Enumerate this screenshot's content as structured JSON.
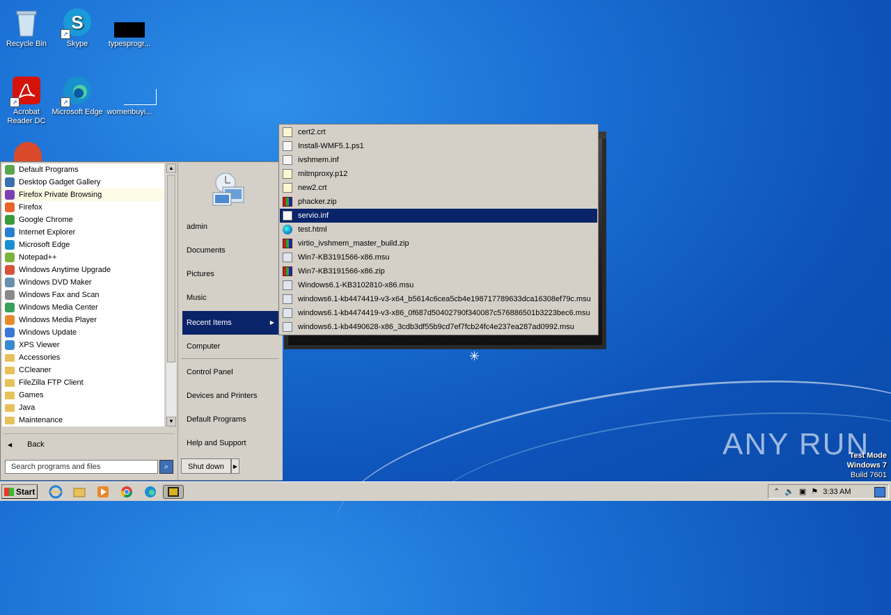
{
  "desktop": {
    "icons": [
      {
        "label": "Recycle Bin"
      },
      {
        "label": "Skype"
      },
      {
        "label": "typesprogr..."
      },
      {
        "label": "Acrobat Reader DC"
      },
      {
        "label": "Microsoft Edge"
      },
      {
        "label": "womenbuyi..."
      }
    ]
  },
  "start_menu": {
    "programs": [
      {
        "label": "Default Programs",
        "icon": "default-programs-icon",
        "color": "#5aa64a"
      },
      {
        "label": "Desktop Gadget Gallery",
        "icon": "gadget-icon",
        "color": "#3a6fb0"
      },
      {
        "label": "Firefox Private Browsing",
        "icon": "firefox-private-icon",
        "color": "#7b3fb5"
      },
      {
        "label": "Firefox",
        "icon": "firefox-icon",
        "color": "#e8632b"
      },
      {
        "label": "Google Chrome",
        "icon": "chrome-icon",
        "color": "#3a9a3a"
      },
      {
        "label": "Internet Explorer",
        "icon": "ie-icon",
        "color": "#2a7fd4"
      },
      {
        "label": "Microsoft Edge",
        "icon": "edge-icon",
        "color": "#1a8fd0"
      },
      {
        "label": "Notepad++",
        "icon": "notepadpp-icon",
        "color": "#7ab342"
      },
      {
        "label": "Windows Anytime Upgrade",
        "icon": "windows-flag-icon",
        "color": "#d9533a"
      },
      {
        "label": "Windows DVD Maker",
        "icon": "dvd-maker-icon",
        "color": "#6a8fb0"
      },
      {
        "label": "Windows Fax and Scan",
        "icon": "fax-icon",
        "color": "#8a8a8a"
      },
      {
        "label": "Windows Media Center",
        "icon": "media-center-icon",
        "color": "#3aa05a"
      },
      {
        "label": "Windows Media Player",
        "icon": "media-player-icon",
        "color": "#e8882b"
      },
      {
        "label": "Windows Update",
        "icon": "windows-update-icon",
        "color": "#3a7ad4"
      },
      {
        "label": "XPS Viewer",
        "icon": "xps-viewer-icon",
        "color": "#3a8ad0"
      },
      {
        "label": "Accessories",
        "icon": "folder-icon"
      },
      {
        "label": "CCleaner",
        "icon": "folder-icon"
      },
      {
        "label": "FileZilla FTP Client",
        "icon": "folder-icon"
      },
      {
        "label": "Games",
        "icon": "folder-icon"
      },
      {
        "label": "Java",
        "icon": "folder-icon"
      },
      {
        "label": "Maintenance",
        "icon": "folder-icon"
      }
    ],
    "back_label": "Back",
    "search_placeholder": "Search programs and files",
    "right": {
      "user": "admin",
      "documents": "Documents",
      "pictures": "Pictures",
      "music": "Music",
      "recent_items": "Recent Items",
      "computer": "Computer",
      "control_panel": "Control Panel",
      "devices_printers": "Devices and Printers",
      "default_programs": "Default Programs",
      "help_support": "Help and Support"
    },
    "shutdown_label": "Shut down"
  },
  "recent_items": [
    {
      "label": "cert2.crt",
      "type": "cert"
    },
    {
      "label": "Install-WMF5.1.ps1",
      "type": "script"
    },
    {
      "label": "ivshmem.inf",
      "type": "inf"
    },
    {
      "label": "mitmproxy.p12",
      "type": "cert"
    },
    {
      "label": "new2.crt",
      "type": "cert"
    },
    {
      "label": "phacker.zip",
      "type": "zip"
    },
    {
      "label": "servio.inf",
      "type": "inf",
      "selected": true
    },
    {
      "label": "test.html",
      "type": "edge"
    },
    {
      "label": "virtio_ivshmem_master_build.zip",
      "type": "zip"
    },
    {
      "label": "Win7-KB3191566-x86.msu",
      "type": "msu"
    },
    {
      "label": "Win7-KB3191566-x86.zip",
      "type": "zip"
    },
    {
      "label": "Windows6.1-KB3102810-x86.msu",
      "type": "msu"
    },
    {
      "label": "windows6.1-kb4474419-v3-x64_b5614c6cea5cb4e198717789633dca16308ef79c.msu",
      "type": "msu"
    },
    {
      "label": "windows6.1-kb4474419-v3-x86_0f687d50402790f340087c576886501b3223bec6.msu",
      "type": "msu"
    },
    {
      "label": "windows6.1-kb4490628-x86_3cdb3df55b9cd7ef7fcb24fc4e237ea287ad0992.msu",
      "type": "msu"
    }
  ],
  "taskbar": {
    "start_label": "Start",
    "clock": "3:33 AM"
  },
  "watermark": "ANY RUN",
  "test_mode": {
    "line1": "Test Mode",
    "line2": "Windows 7",
    "line3": "Build 7601"
  }
}
